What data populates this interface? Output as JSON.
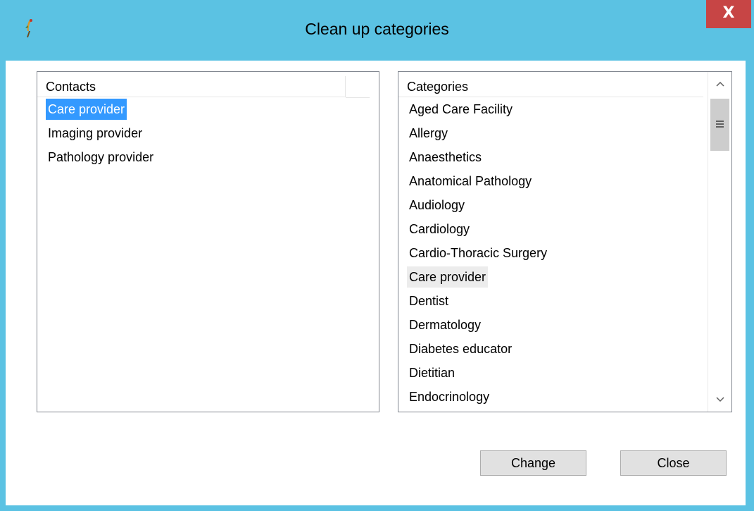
{
  "window": {
    "title": "Clean up categories",
    "close_glyph": "X",
    "app_icon": "bird-feather-icon"
  },
  "contacts": {
    "header": "Contacts",
    "items": [
      {
        "label": "Care provider",
        "selected": true
      },
      {
        "label": "Imaging provider",
        "selected": false
      },
      {
        "label": "Pathology provider",
        "selected": false
      }
    ]
  },
  "categories": {
    "header": "Categories",
    "items": [
      {
        "label": "Aged Care Facility"
      },
      {
        "label": "Allergy"
      },
      {
        "label": "Anaesthetics"
      },
      {
        "label": "Anatomical Pathology"
      },
      {
        "label": "Audiology"
      },
      {
        "label": "Cardiology"
      },
      {
        "label": "Cardio-Thoracic Surgery"
      },
      {
        "label": "Care provider",
        "hover": true
      },
      {
        "label": "Dentist"
      },
      {
        "label": "Dermatology"
      },
      {
        "label": "Diabetes educator"
      },
      {
        "label": "Dietitian"
      },
      {
        "label": "Endocrinology"
      }
    ],
    "scroll_up_glyph": "^",
    "scroll_down_glyph": "v"
  },
  "buttons": {
    "change_label": "Change",
    "close_label": "Close"
  },
  "colors": {
    "titlebar": "#5bc2e3",
    "close_button": "#c74545",
    "selection": "#3399ff"
  }
}
